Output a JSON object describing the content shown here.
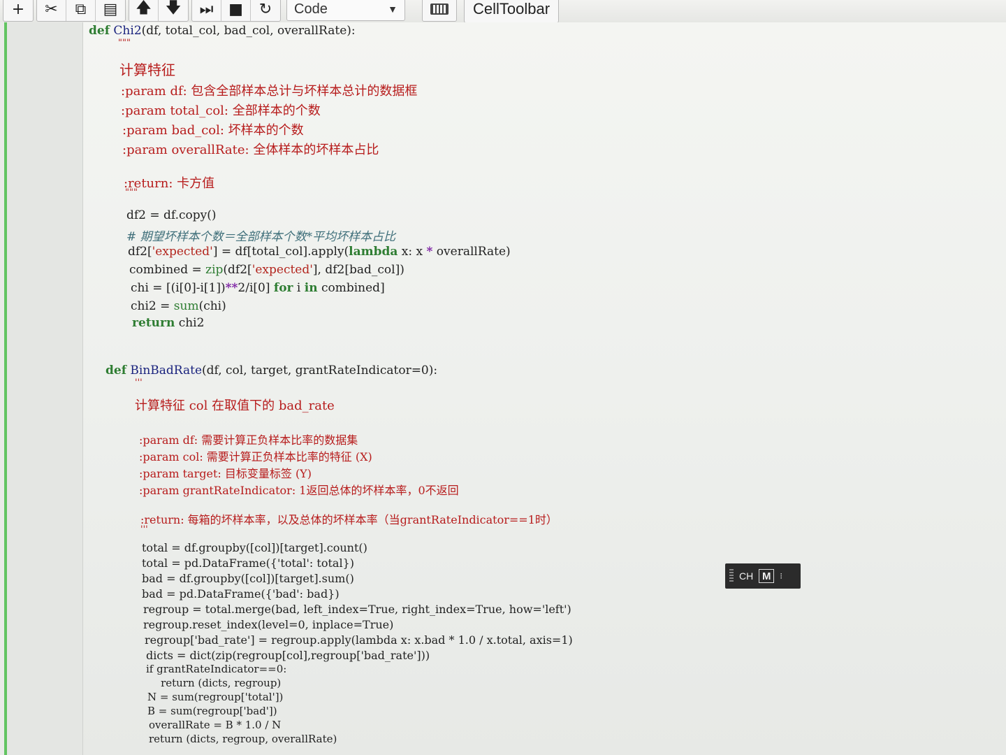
{
  "toolbar": {
    "cell_type": "Code",
    "cell_toolbar_label": "CellToolbar"
  },
  "code": {
    "chi2": {
      "def_line": {
        "kw": "def",
        "name": "Chi2",
        "args": "(df, total_col, bad_col, overallRate):"
      },
      "doc_open": "\"\"\"",
      "doc_title": "计算特征",
      "doc_params": [
        ":param df: 包含全部样本总计与坏样本总计的数据框",
        ":param total_col: 全部样本的个数",
        ":param bad_col: 坏样本的个数",
        ":param overallRate: 全体样本的坏样本占比"
      ],
      "doc_return": ":return: 卡方值",
      "doc_close": "\"\"\"",
      "l1": "df2 = df.copy()",
      "comment": "# 期望坏样本个数＝全部样本个数*平均坏样本占比",
      "l3a": "df2[",
      "l3b": "'expected'",
      "l3c": "] = df[total_col].apply(",
      "l3d": "lambda",
      "l3e": " x: x ",
      "l3f": "*",
      "l3g": " overallRate)",
      "l4a": "combined = ",
      "l4b": "zip",
      "l4c": "(df2[",
      "l4d": "'expected'",
      "l4e": "], df2[bad_col])",
      "l5a": "chi = [(i[0]-i[1])",
      "l5b": "**",
      "l5c": "2/i[0] ",
      "l5d": "for",
      "l5e": " i ",
      "l5f": "in",
      "l5g": " combined]",
      "l6a": "chi2 = ",
      "l6b": "sum",
      "l6c": "(chi)",
      "l7a": "return",
      "l7b": " chi2"
    },
    "binbad": {
      "def_line": {
        "kw": "def",
        "name": "BinBadRate",
        "args": "(df, col, target, grantRateIndicator=0):"
      },
      "doc_open": "'''",
      "doc_title": "计算特征 col 在取值下的 bad_rate",
      "doc_params": [
        ":param df: 需要计算正负样本比率的数据集",
        ":param col: 需要计算正负样本比率的特征 (X)",
        ":param target: 目标变量标签 (Y)",
        ":param grantRateIndicator: 1返回总体的坏样本率，0不返回"
      ],
      "doc_return": ":return: 每箱的坏样本率，以及总体的坏样本率（当grantRateIndicator==1时）",
      "doc_close": "'''",
      "lines": [
        "total = df.groupby([col])[target].count()",
        "total = pd.DataFrame({'total': total})",
        "bad = df.groupby([col])[target].sum()",
        "bad = pd.DataFrame({'bad': bad})",
        "regroup = total.merge(bad, left_index=True, right_index=True, how='left')",
        "regroup.reset_index(level=0, inplace=True)",
        "regroup['bad_rate'] = regroup.apply(lambda x: x.bad * 1.0 / x.total, axis=1)",
        "dicts = dict(zip(regroup[col],regroup['bad_rate']))",
        "if grantRateIndicator==0:",
        "    return (dicts, regroup)",
        "N = sum(regroup['total'])",
        "B = sum(regroup['bad'])",
        "overallRate = B * 1.0 / N",
        "return (dicts, regroup, overallRate)"
      ]
    }
  },
  "ime": {
    "lang": "CH",
    "mode": "M"
  }
}
